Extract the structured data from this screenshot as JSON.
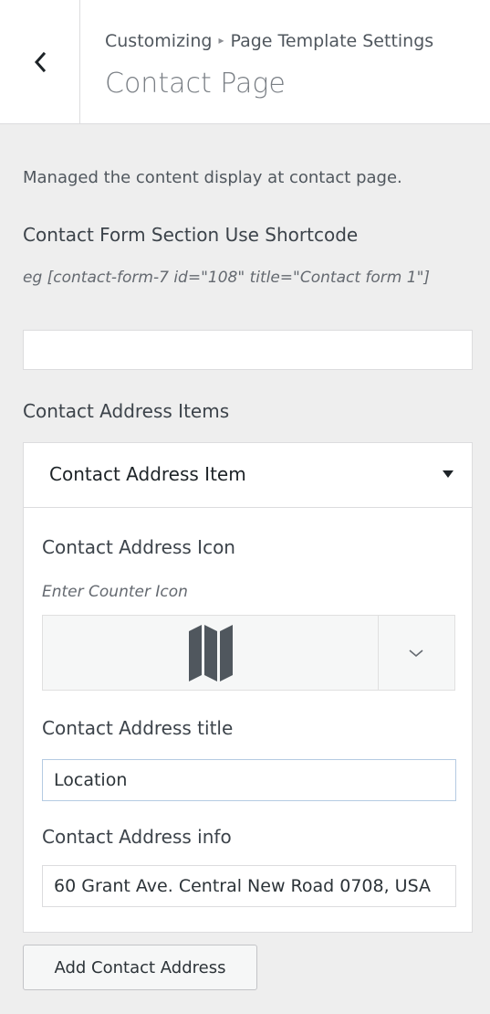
{
  "header": {
    "breadcrumb_root": "Customizing",
    "breadcrumb_separator": "▸",
    "breadcrumb_parent": "Page Template Settings",
    "title": "Contact Page"
  },
  "section": {
    "description": "Managed the content display at contact page.",
    "shortcode_label": "Contact Form Section Use Shortcode",
    "shortcode_hint": "eg [contact-form-7 id=\"108\" title=\"Contact form 1\"]",
    "shortcode_value": "",
    "items_label": "Contact Address Items"
  },
  "item": {
    "header_title": "Contact Address Item",
    "icon_label": "Contact Address Icon",
    "icon_hint": "Enter Counter Icon",
    "icon_name": "map-icon",
    "title_label": "Contact Address title",
    "title_value": "Location",
    "info_label": "Contact Address info",
    "info_value": "60 Grant Ave. Central New Road 0708, USA"
  },
  "add_button_label": "Add Contact Address",
  "colors": {
    "panel_bg": "#eeeeee",
    "focus_border": "#b5cbe2",
    "icon_fill": "#50575e"
  }
}
